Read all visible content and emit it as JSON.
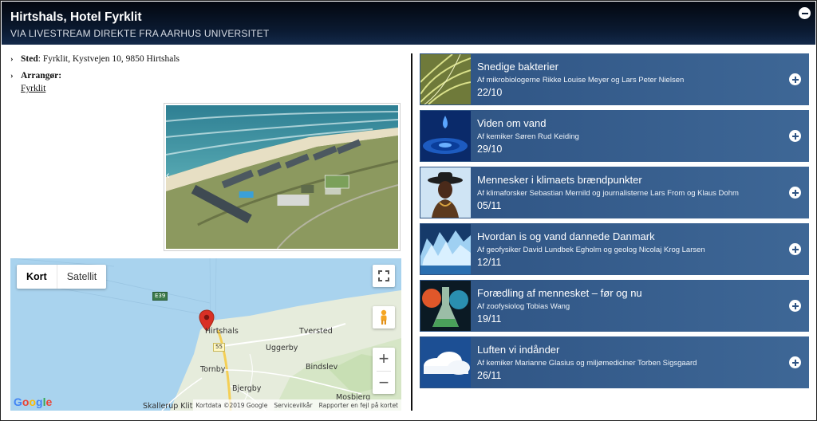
{
  "header": {
    "title": "Hirtshals, Hotel Fyrklit",
    "subtitle": "VIA LIVESTREAM DIREKTE FRA AARHUS UNIVERSITET"
  },
  "info": {
    "venue_label": "Sted",
    "venue_value": "Fyrklit, Kystvejen 10, 9850 Hirtshals",
    "organizer_label": "Arrangør:",
    "organizer_link": "Fyrklit"
  },
  "map": {
    "type_map": "Kort",
    "type_satellite": "Satellit",
    "towns": {
      "hirtshals": "Hirtshals",
      "tversted": "Tversted",
      "uggerby": "Uggerby",
      "bindslev": "Bindslev",
      "tornby": "Tornby",
      "bjergby": "Bjergby",
      "mosbjerg": "Mosbjerg",
      "skallerup": "Skallerup Klit"
    },
    "roads": {
      "e39": "E39",
      "r55": "55"
    },
    "zoom_in": "+",
    "zoom_out": "−",
    "google": "Google",
    "attribution": {
      "data": "Kortdata ©2019 Google",
      "terms": "Servicevilkår",
      "report": "Rapporter en fejl på kortet"
    }
  },
  "events": [
    {
      "title": "Snedige bakterier",
      "by": "Af mikrobiologerne Rikke Louise Meyer og Lars Peter Nielsen",
      "date": "22/10",
      "thumb": "bacteria-thumb"
    },
    {
      "title": "Viden om vand",
      "by": "Af kemiker Søren Rud Keiding",
      "date": "29/10",
      "thumb": "water-drop-thumb"
    },
    {
      "title": "Mennesker i klimaets brændpunkter",
      "by": "Af klimaforsker Sebastian Mernild og journalisterne Lars From og Klaus Dohm",
      "date": "05/11",
      "thumb": "person-thumb"
    },
    {
      "title": "Hvordan is og vand dannede Danmark",
      "by": "Af geofysiker David Lundbek Egholm og geolog Nicolaj Krog Larsen",
      "date": "12/11",
      "thumb": "glacier-thumb"
    },
    {
      "title": "Forædling af mennesket – før og nu",
      "by": "Af zoofysiolog Tobias Wang",
      "date": "19/11",
      "thumb": "flask-thumb"
    },
    {
      "title": "Luften vi indånder",
      "by": "Af kemiker Marianne Glasius og miljømediciner Torben Sigsgaard",
      "date": "26/11",
      "thumb": "cloud-thumb"
    }
  ],
  "colors": {
    "header_bg": "#0b1b33",
    "event_bg": "#2e5383",
    "map_water": "#a9d3ee",
    "marker": "#d93025"
  }
}
